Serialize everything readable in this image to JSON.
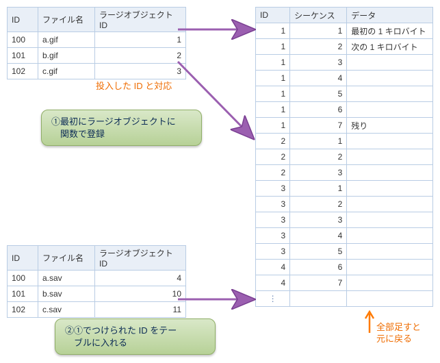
{
  "table_top": {
    "headers": [
      "ID",
      "ファイル名",
      "ラージオブジェクト ID"
    ],
    "rows": [
      {
        "id": "100",
        "file": "a.gif",
        "lo": "1"
      },
      {
        "id": "101",
        "file": "b.gif",
        "lo": "2"
      },
      {
        "id": "102",
        "file": "c.gif",
        "lo": "3"
      }
    ]
  },
  "table_bottom": {
    "headers": [
      "ID",
      "ファイル名",
      "ラージオブジェクト ID"
    ],
    "rows": [
      {
        "id": "100",
        "file": "a.sav",
        "lo": "4"
      },
      {
        "id": "101",
        "file": "b.sav",
        "lo": "10"
      },
      {
        "id": "102",
        "file": "c.sav",
        "lo": "11"
      }
    ]
  },
  "table_right": {
    "headers": [
      "ID",
      "シーケンス",
      "データ"
    ],
    "rows": [
      {
        "id": "1",
        "seq": "1",
        "data": "最初の 1 キロバイト"
      },
      {
        "id": "1",
        "seq": "2",
        "data": "次の 1 キロバイト"
      },
      {
        "id": "1",
        "seq": "3",
        "data": ""
      },
      {
        "id": "1",
        "seq": "4",
        "data": ""
      },
      {
        "id": "1",
        "seq": "5",
        "data": ""
      },
      {
        "id": "1",
        "seq": "6",
        "data": ""
      },
      {
        "id": "1",
        "seq": "7",
        "data": "残り"
      },
      {
        "id": "2",
        "seq": "1",
        "data": ""
      },
      {
        "id": "2",
        "seq": "2",
        "data": ""
      },
      {
        "id": "2",
        "seq": "3",
        "data": ""
      },
      {
        "id": "3",
        "seq": "1",
        "data": ""
      },
      {
        "id": "3",
        "seq": "2",
        "data": ""
      },
      {
        "id": "3",
        "seq": "3",
        "data": ""
      },
      {
        "id": "3",
        "seq": "4",
        "data": ""
      },
      {
        "id": "3",
        "seq": "5",
        "data": ""
      },
      {
        "id": "4",
        "seq": "6",
        "data": ""
      },
      {
        "id": "4",
        "seq": "7",
        "data": ""
      }
    ],
    "ellipsis": "⋮"
  },
  "annotations": {
    "corresponds": "投入した ID と対応",
    "callout1_line1": "①最初にラージオブジェクトに",
    "callout1_line2": "　関数で登録",
    "callout2_line1": "②①でつけられた ID をテー",
    "callout2_line2": "　ブルに入れる",
    "sum_label_1": "全部足すと",
    "sum_label_2": "元に戻る"
  },
  "colors": {
    "border": "#b8cce4",
    "header_bg": "#e9eff7",
    "orange": "#ef6c00",
    "arrow": "#9b5fb0",
    "arrow_orange": "#ff7a00"
  }
}
